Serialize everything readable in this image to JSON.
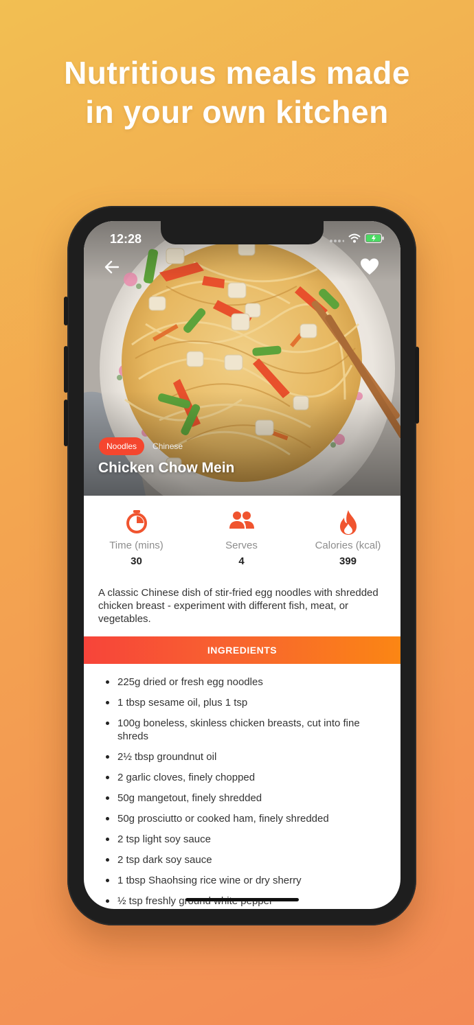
{
  "headline": {
    "line1": "Nutritious meals made",
    "line2": "in your own kitchen"
  },
  "status_bar": {
    "time": "12:28",
    "signal_icon": "signal-dots-icon",
    "wifi_icon": "wifi-icon",
    "battery_icon": "battery-charging-icon"
  },
  "hero": {
    "image_description_icon": "chow-mein-photo",
    "back_icon": "back-arrow-icon",
    "favorite_icon": "heart-icon"
  },
  "recipe": {
    "tags": [
      "Noodles",
      "Chinese"
    ],
    "title": "Chicken Chow Mein"
  },
  "stats": [
    {
      "icon": "timer-icon",
      "label": "Time (mins)",
      "value": "30"
    },
    {
      "icon": "people-icon",
      "label": "Serves",
      "value": "4"
    },
    {
      "icon": "flame-icon",
      "label": "Calories (kcal)",
      "value": "399"
    }
  ],
  "description": "A classic Chinese dish of stir-fried egg noodles with shredded chicken breast - experiment with different fish, meat, or vegetables.",
  "ingredients": {
    "heading": "INGREDIENTS",
    "items": [
      "225g dried or fresh egg noodles",
      "1 tbsp sesame oil, plus 1 tsp",
      "100g boneless, skinless chicken breasts, cut into fine shreds",
      "2½ tbsp groundnut oil",
      "2 garlic cloves, finely chopped",
      "50g mangetout, finely shredded",
      "50g prosciutto or cooked ham, finely shredded",
      "2 tsp light soy sauce",
      "2 tsp dark soy sauce",
      "1 tbsp Shaohsing rice wine or dry sherry",
      "½ tsp freshly ground white pepper"
    ]
  },
  "colors": {
    "accent": "#f5462e",
    "icon_orange": "#f0542f",
    "gradient_start": "#f7443a",
    "gradient_end": "#fb8614"
  }
}
